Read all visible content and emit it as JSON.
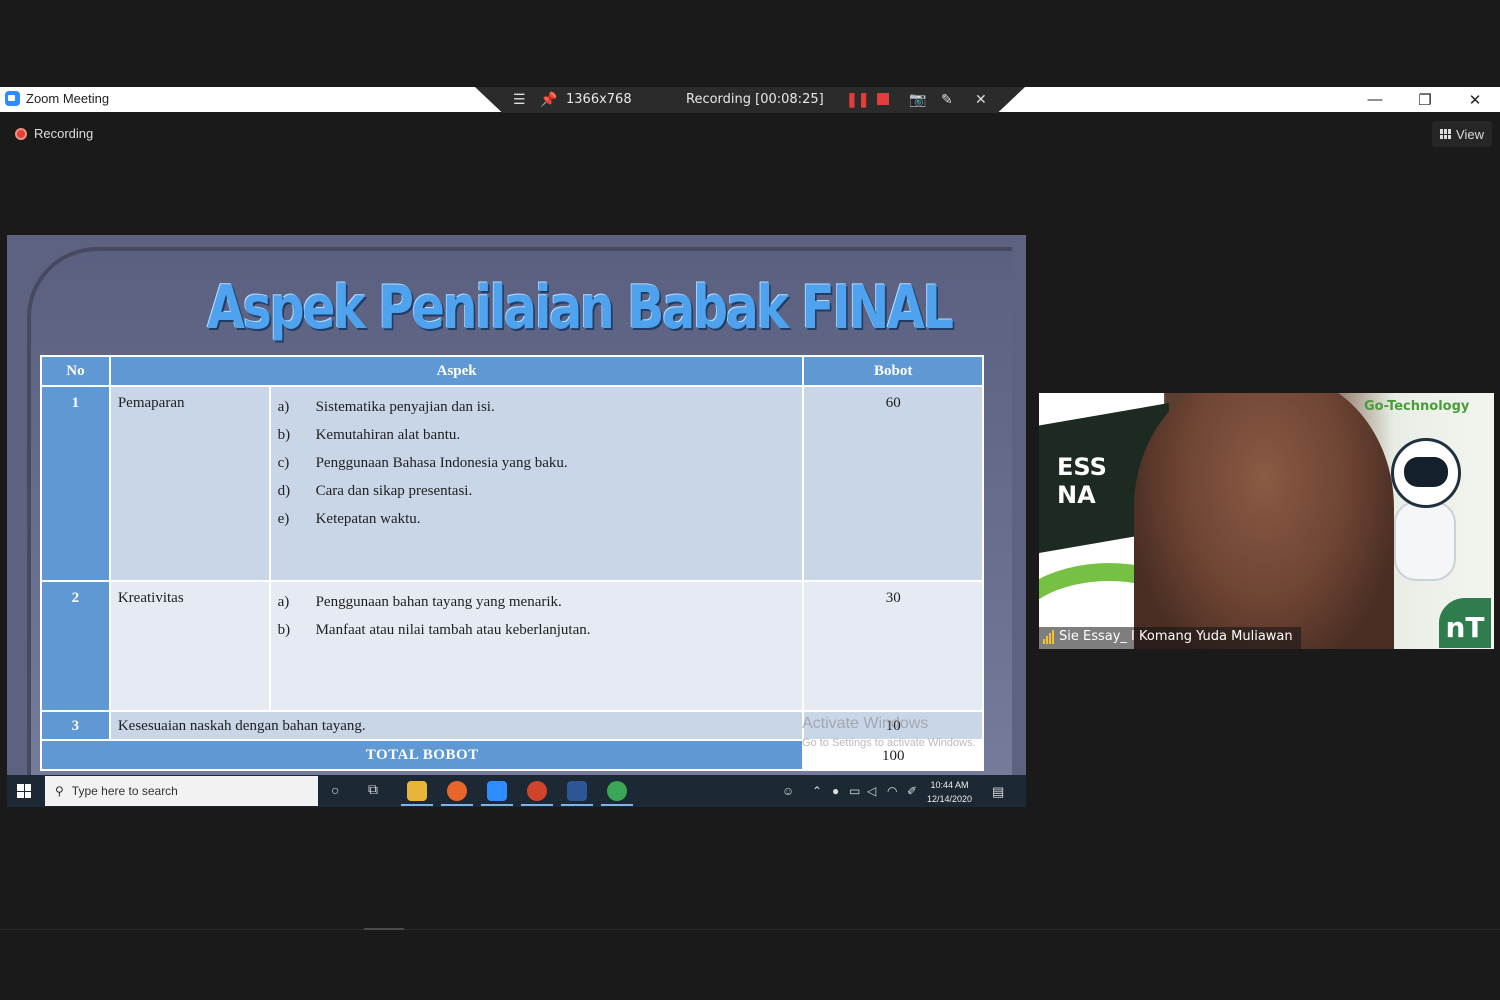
{
  "window": {
    "title": "Zoom Meeting",
    "controls": [
      "—",
      "❐",
      "✕"
    ]
  },
  "recording_toolbar": {
    "resolution": "1366x768",
    "status": "Recording [00:08:25]"
  },
  "recording_indicator": "Recording",
  "view_button": "View",
  "slide": {
    "title": "Aspek Penilaian Babak FINAL",
    "headers": {
      "no": "No",
      "aspek": "Aspek",
      "bobot": "Bobot"
    },
    "rows": [
      {
        "no": "1",
        "name": "Pemaparan",
        "items": [
          {
            "key": "a)",
            "text": "Sistematika penyajian dan isi."
          },
          {
            "key": "b)",
            "text": "Kemutahiran alat bantu."
          },
          {
            "key": "c)",
            "text": "Penggunaan Bahasa Indonesia yang baku."
          },
          {
            "key": "d)",
            "text": "Cara dan sikap presentasi."
          },
          {
            "key": "e)",
            "text": "Ketepatan waktu."
          }
        ],
        "bobot": "60"
      },
      {
        "no": "2",
        "name": "Kreativitas",
        "items": [
          {
            "key": "a)",
            "text": "Penggunaan bahan tayang yang menarik."
          },
          {
            "key": "b)",
            "text": "Manfaat atau nilai tambah atau keberlanjutan."
          }
        ],
        "bobot": "30"
      },
      {
        "no": "3",
        "name": "Kesesuaian naskah dengan bahan tayang.",
        "bobot": "10"
      }
    ],
    "total_label": "TOTAL BOBOT",
    "total_value": "100",
    "watermark_line1": "Activate Windows",
    "watermark_line2": "Go to Settings to activate Windows."
  },
  "taskbar": {
    "search_placeholder": "Type here to search",
    "time": "10:44 AM",
    "date": "12/14/2020"
  },
  "participant": {
    "name": "Sie Essay_ I Komang Yuda Muliawan",
    "background_text_1": "ESS",
    "background_text_2": "NA",
    "background_brand": "Go-Technology",
    "background_logo": "nT"
  }
}
